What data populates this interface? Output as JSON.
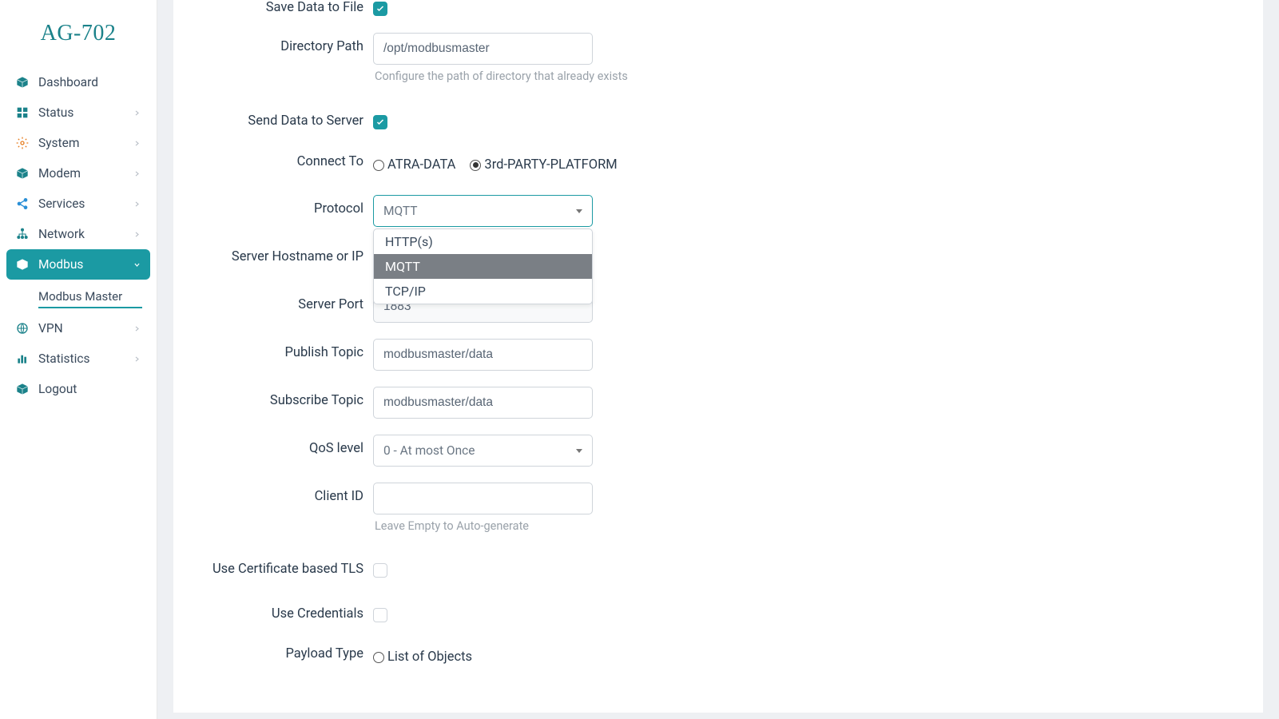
{
  "brand": "AG-702",
  "sidebar": {
    "items": [
      {
        "label": "Dashboard",
        "icon": "cube-icon",
        "color": "i-teal",
        "expandable": false
      },
      {
        "label": "Status",
        "icon": "grid-icon",
        "color": "i-teal",
        "expandable": true
      },
      {
        "label": "System",
        "icon": "gear-icon",
        "color": "i-orange",
        "expandable": true
      },
      {
        "label": "Modem",
        "icon": "cube-icon",
        "color": "i-teal",
        "expandable": true
      },
      {
        "label": "Services",
        "icon": "share-icon",
        "color": "i-blue",
        "expandable": true
      },
      {
        "label": "Network",
        "icon": "tree-icon",
        "color": "i-teal",
        "expandable": true
      },
      {
        "label": "Modbus",
        "icon": "cube-icon",
        "color": "i-white",
        "expandable": true,
        "active": true,
        "open": true,
        "children": [
          {
            "label": "Modbus Master",
            "active": true
          }
        ]
      },
      {
        "label": "VPN",
        "icon": "globe-icon",
        "color": "i-teal",
        "expandable": true
      },
      {
        "label": "Statistics",
        "icon": "bars-icon",
        "color": "i-teal",
        "expandable": true
      },
      {
        "label": "Logout",
        "icon": "cube-icon",
        "color": "i-teal",
        "expandable": false
      }
    ]
  },
  "form": {
    "save_to_file": {
      "label": "Save Data to File",
      "checked": true
    },
    "directory_path": {
      "label": "Directory Path",
      "value": "/opt/modbusmaster",
      "helper": "Configure the path of directory that already exists"
    },
    "send_to_server": {
      "label": "Send Data to Server",
      "checked": true
    },
    "connect_to": {
      "label": "Connect To",
      "options": [
        "ATRA-DATA",
        "3rd-PARTY-PLATFORM"
      ],
      "selected": "3rd-PARTY-PLATFORM"
    },
    "protocol": {
      "label": "Protocol",
      "value": "MQTT",
      "options": [
        "HTTP(s)",
        "MQTT",
        "TCP/IP"
      ]
    },
    "server_host": {
      "label": "Server Hostname or IP",
      "value": ""
    },
    "server_port": {
      "label": "Server Port",
      "value": "1883"
    },
    "publish_topic": {
      "label": "Publish Topic",
      "value": "modbusmaster/data"
    },
    "subscribe_topic": {
      "label": "Subscribe Topic",
      "value": "modbusmaster/data"
    },
    "qos": {
      "label": "QoS level",
      "value": "0 - At most Once"
    },
    "client_id": {
      "label": "Client ID",
      "value": "",
      "helper": "Leave Empty to Auto-generate"
    },
    "use_tls": {
      "label": "Use Certificate based TLS",
      "checked": false
    },
    "use_creds": {
      "label": "Use Credentials",
      "checked": false
    },
    "payload_type": {
      "label": "Payload Type",
      "options": [
        "List of Objects"
      ],
      "selected": ""
    }
  }
}
